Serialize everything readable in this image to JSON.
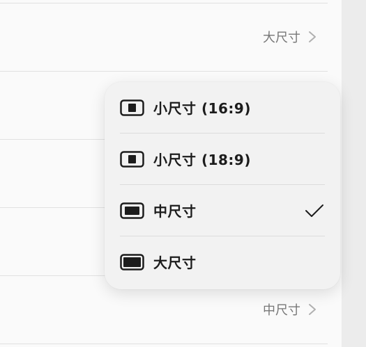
{
  "background_rows": [
    {
      "value": "大尺寸"
    },
    {
      "value": "中尺寸"
    }
  ],
  "menu": {
    "items": [
      {
        "label": "小尺寸 (16:9)",
        "icon": "small-screen-icon",
        "selected": false
      },
      {
        "label": "小尺寸 (18:9)",
        "icon": "small-screen-icon",
        "selected": false
      },
      {
        "label": "中尺寸",
        "icon": "medium-screen-icon",
        "selected": true
      },
      {
        "label": "大尺寸",
        "icon": "large-screen-icon",
        "selected": false
      }
    ]
  },
  "colors": {
    "accent": "#1c1c1c",
    "secondary_text": "#777777",
    "menu_background": "#f2f2f2"
  }
}
